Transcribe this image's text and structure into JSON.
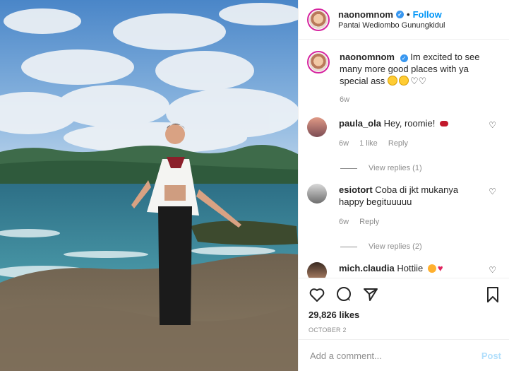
{
  "header": {
    "username": "naonomnom",
    "follow_label": "Follow",
    "location": "Pantai Wediombo Gunungkidul"
  },
  "caption": {
    "username": "naonomnom",
    "text": "Im excited to see many more good places with ya special ass",
    "time": "6w"
  },
  "comments": [
    {
      "username": "paula_ola",
      "text": "Hey, roomie!",
      "time": "6w",
      "likes": "1 like",
      "reply": "Reply",
      "view_replies": "View replies (1)"
    },
    {
      "username": "esiotort",
      "text": "Coba di jkt mukanya happy begituuuuu",
      "time": "6w",
      "reply": "Reply",
      "view_replies": "View replies (2)"
    },
    {
      "username": "mich.claudia",
      "text": "Hottiie"
    }
  ],
  "actions": {
    "likes": "29,826 likes",
    "date": "OCTOBER 2"
  },
  "add_comment": {
    "placeholder": "Add a comment...",
    "post_label": "Post"
  },
  "colors": {
    "accent": "#0095f6",
    "verified": "#3897f0",
    "muted": "#8e8e8e"
  }
}
